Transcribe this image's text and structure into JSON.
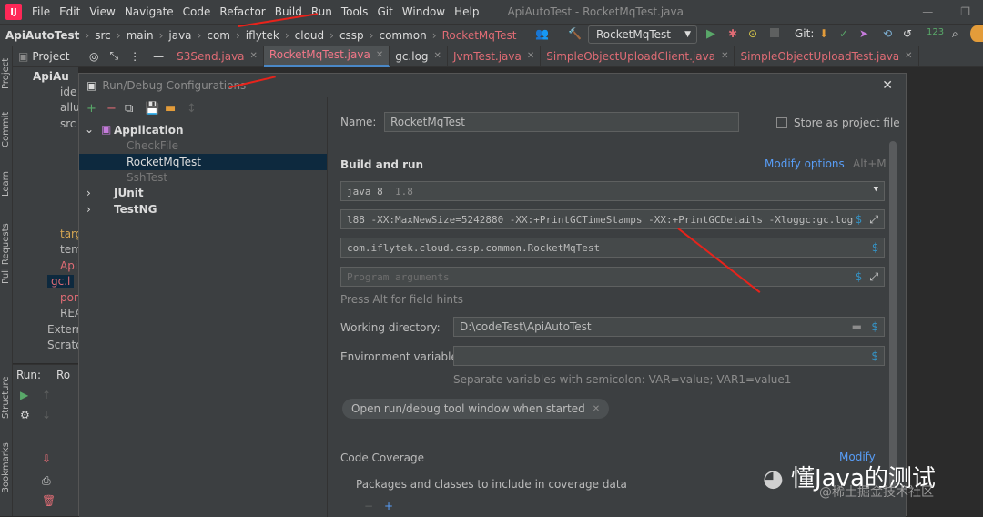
{
  "menubar": {
    "items": [
      "File",
      "Edit",
      "View",
      "Navigate",
      "Code",
      "Refactor",
      "Build",
      "Run",
      "Tools",
      "Git",
      "Window",
      "Help"
    ],
    "window_title": "ApiAutoTest - RocketMqTest.java"
  },
  "breadcrumb": [
    "ApiAutoTest",
    "src",
    "main",
    "java",
    "com",
    "iflytek",
    "cloud",
    "cssp",
    "common",
    "RocketMqTest"
  ],
  "run_config": "RocketMqTest",
  "git_label": "Git:",
  "tabs": [
    {
      "label": "S3Send.java",
      "active": false
    },
    {
      "label": "RocketMqTest.java",
      "active": true
    },
    {
      "label": "gc.log",
      "active": false
    },
    {
      "label": "JvmTest.java",
      "active": false
    },
    {
      "label": "SimpleObjectUploadClient.java",
      "active": false
    },
    {
      "label": "SimpleObjectUploadTest.java",
      "active": false
    }
  ],
  "project_panel": {
    "title": "Project",
    "items": [
      "ApiAu",
      "ide",
      "allu",
      "src",
      "targ",
      "tem",
      "Api",
      "gc.l",
      "pom",
      "REA",
      "Externa",
      "Scratch"
    ]
  },
  "side_tabs": [
    "Project",
    "Commit",
    "Learn",
    "Pull Requests",
    "Structure",
    "Bookmarks"
  ],
  "run_panel": {
    "label": "Run:",
    "tab": "Ro"
  },
  "dialog": {
    "title": "Run/Debug Configurations",
    "tree": {
      "application": "Application",
      "children": [
        "CheckFile",
        "RocketMqTest",
        "SshTest"
      ],
      "junit": "JUnit",
      "testng": "TestNG"
    },
    "name_label": "Name:",
    "name_value": "RocketMqTest",
    "store_label": "Store as project file",
    "build_run": "Build and run",
    "modify_options": "Modify options",
    "modify_shortcut": "Alt+M",
    "jdk": "java 8",
    "jdk_version": "1.8",
    "vm_options": "l88  -XX:MaxNewSize=5242880 -XX:+PrintGCTimeStamps -XX:+PrintGCDetails -Xloggc:gc.log",
    "main_class": "com.iflytek.cloud.cssp.common.RocketMqTest",
    "program_args_placeholder": "Program arguments",
    "hint": "Press Alt for field hints",
    "working_dir_label": "Working directory:",
    "working_dir": "D:\\codeTest\\ApiAutoTest",
    "env_label": "Environment variables:",
    "env_hint": "Separate variables with semicolon: VAR=value; VAR1=value1",
    "chip": "Open run/debug tool window when started",
    "coverage": "Code Coverage",
    "modify": "Modify",
    "packages": "Packages and classes to include in coverage data"
  },
  "watermark": {
    "main": "懂Java的测试",
    "sub": "@稀土掘金技术社区"
  },
  "accent": "#589df6"
}
